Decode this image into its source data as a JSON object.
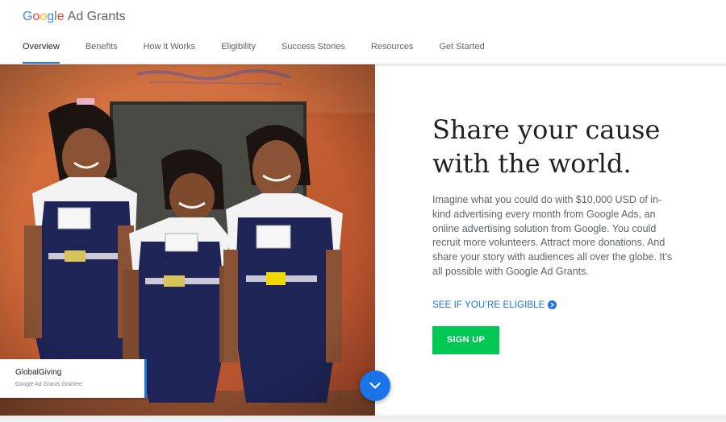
{
  "header": {
    "logo_google": [
      "G",
      "o",
      "o",
      "g",
      "l",
      "e"
    ],
    "logo_google_colors": [
      "#4285F4",
      "#EA4335",
      "#FBBC05",
      "#4285F4",
      "#34A853",
      "#EA4335"
    ],
    "logo_product": "Ad Grants",
    "nav": [
      {
        "label": "Overview",
        "active": true
      },
      {
        "label": "Benefits",
        "active": false
      },
      {
        "label": "How it Works",
        "active": false
      },
      {
        "label": "Eligibility",
        "active": false
      },
      {
        "label": "Success Stories",
        "active": false
      },
      {
        "label": "Resources",
        "active": false
      },
      {
        "label": "Get Started",
        "active": false
      }
    ]
  },
  "hero": {
    "image_subject": "three smiling schoolgirls in navy uniforms against an orange wall",
    "caption_name": "GlobalGiving",
    "caption_sub": "Google Ad Grants Grantee",
    "scroll_icon": "chevron-down-icon"
  },
  "main": {
    "headline": "Share your cause with the world.",
    "body": "Imagine what you could do with $10,000 USD of in-kind advertising every month from Google Ads, an online advertising solution from Google. You could recruit more volunteers. Attract more donations. And share your story with audiences all over the globe. It’s all possible with Google Ad Grants.",
    "eligible_link": "SEE IF YOU’RE ELIGIBLE",
    "eligible_icon": "arrow-right-circle-icon",
    "signup_button": "SIGN UP"
  },
  "colors": {
    "accent": "#1a73e8",
    "signup": "#00c853",
    "text_dark": "#202124",
    "text_muted": "#5f6368"
  }
}
